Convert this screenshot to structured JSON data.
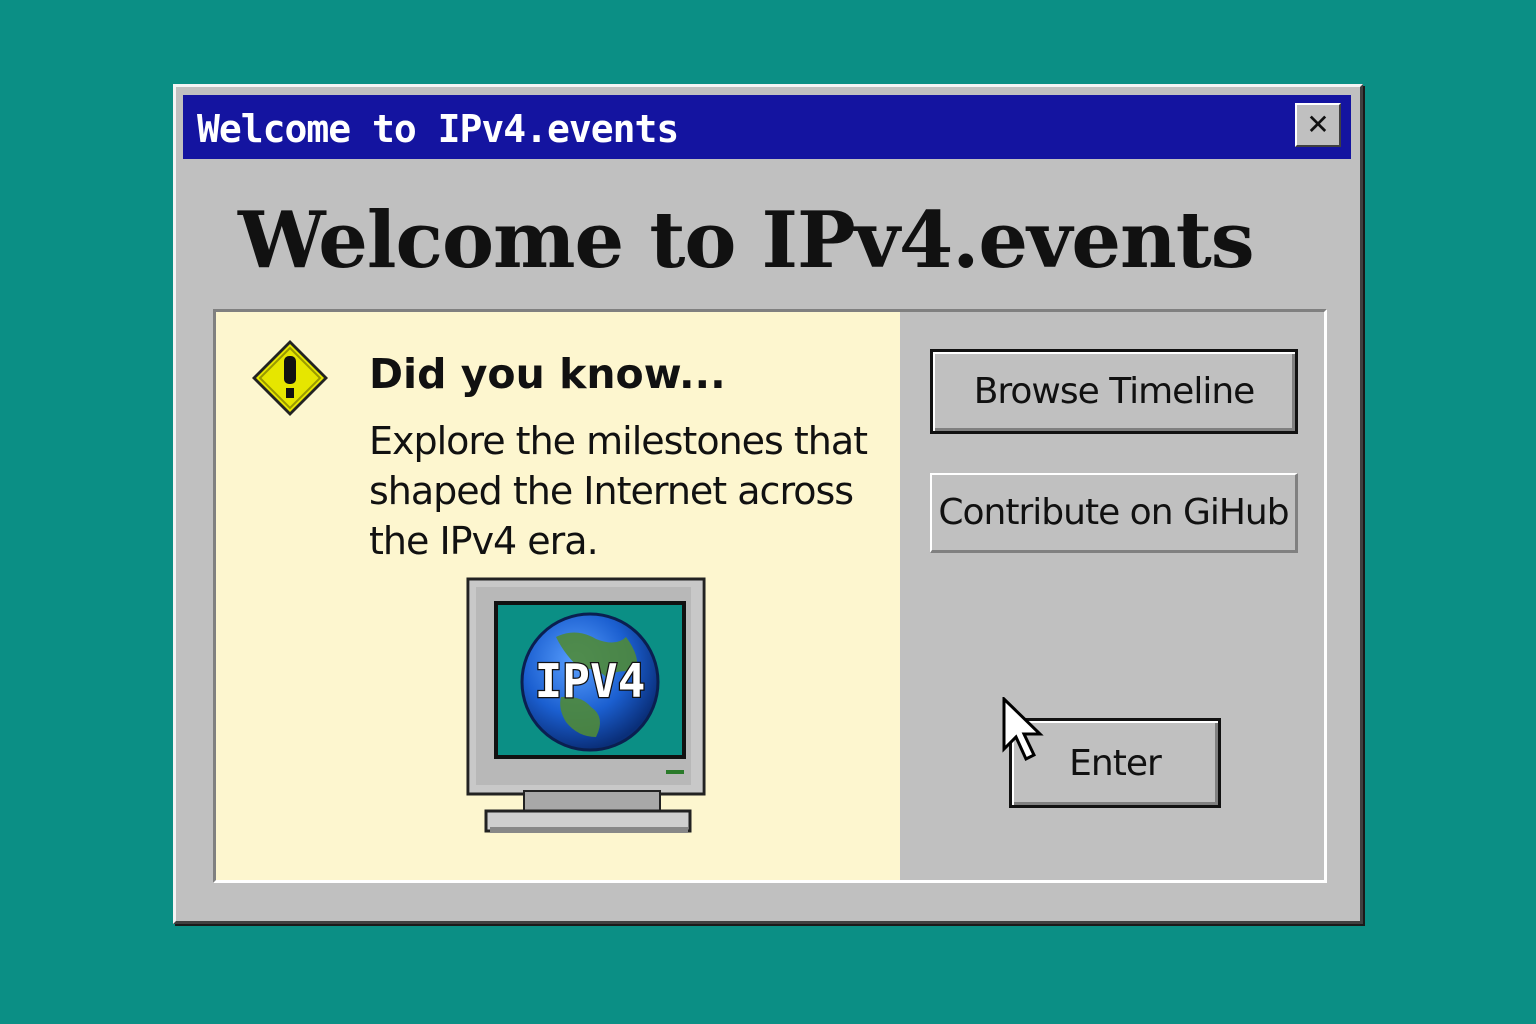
{
  "window": {
    "title": "Welcome to IPv4.events",
    "close_glyph": "✕",
    "heading": "Welcome to IPv4.events"
  },
  "info": {
    "icon": "warning-icon",
    "title": "Did you know...",
    "body": "Explore the milestones that shaped the Internet across the IPv4 era.",
    "monitor_icon": "computer-monitor-globe-icon",
    "globe_label": "IPV4"
  },
  "buttons": {
    "browse": "Browse Timeline",
    "contribute": "Contribute on GiHub",
    "enter": "Enter"
  },
  "colors": {
    "desktop": "#0b8f85",
    "titlebar": "#1414a0",
    "window": "#c0c0c0",
    "info_background": "#fdf6cf",
    "warning_yellow": "#e6e600"
  }
}
